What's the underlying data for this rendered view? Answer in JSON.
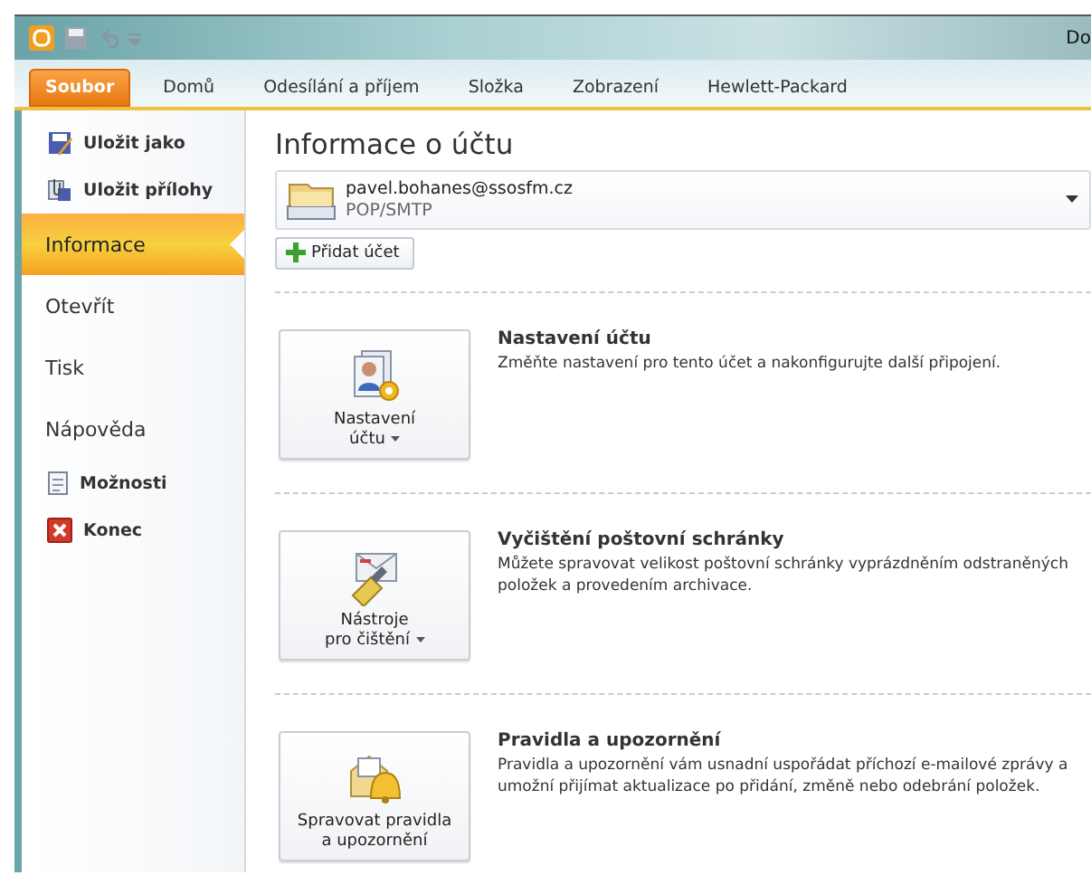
{
  "window": {
    "title": "Do"
  },
  "ribbon_tabs": [
    {
      "label": "Soubor",
      "selected": true
    },
    {
      "label": "Domů",
      "selected": false
    },
    {
      "label": "Odesílání a příjem",
      "selected": false
    },
    {
      "label": "Složka",
      "selected": false
    },
    {
      "label": "Zobrazení",
      "selected": false
    },
    {
      "label": "Hewlett-Packard",
      "selected": false
    }
  ],
  "sidebar": {
    "items": [
      {
        "label": "Uložit jako",
        "kind": "command",
        "selected": false
      },
      {
        "label": "Uložit přílohy",
        "kind": "command",
        "selected": false
      },
      {
        "label": "Informace",
        "kind": "page",
        "selected": true
      },
      {
        "label": "Otevřít",
        "kind": "page",
        "selected": false
      },
      {
        "label": "Tisk",
        "kind": "page",
        "selected": false
      },
      {
        "label": "Nápověda",
        "kind": "page",
        "selected": false
      },
      {
        "label": "Možnosti",
        "kind": "command",
        "selected": false
      },
      {
        "label": "Konec",
        "kind": "command",
        "selected": false
      }
    ]
  },
  "page": {
    "title": "Informace o účtu",
    "account": {
      "email": "pavel.bohanes@ssosfm.cz",
      "type": "POP/SMTP"
    },
    "add_account": "Přidat účet",
    "sections": [
      {
        "button_lines": [
          "Nastavení",
          "účtu"
        ],
        "dropdown": true,
        "heading": "Nastavení účtu",
        "text": "Změňte nastavení pro tento účet a nakonfigurujte další připojení."
      },
      {
        "button_lines": [
          "Nástroje",
          "pro čištění"
        ],
        "dropdown": true,
        "heading": "Vyčištění poštovní schránky",
        "text": "Můžete spravovat velikost poštovní schránky vyprázdněním odstraněných položek a provedením archivace."
      },
      {
        "button_lines": [
          "Spravovat pravidla",
          "a upozornění"
        ],
        "dropdown": false,
        "heading": "Pravidla a upozornění",
        "text": "Pravidla a upozornění vám usnadní uspořádat příchozí e-mailové zprávy a umožní přijímat aktualizace po přidání, změně nebo odebrání položek."
      }
    ]
  }
}
